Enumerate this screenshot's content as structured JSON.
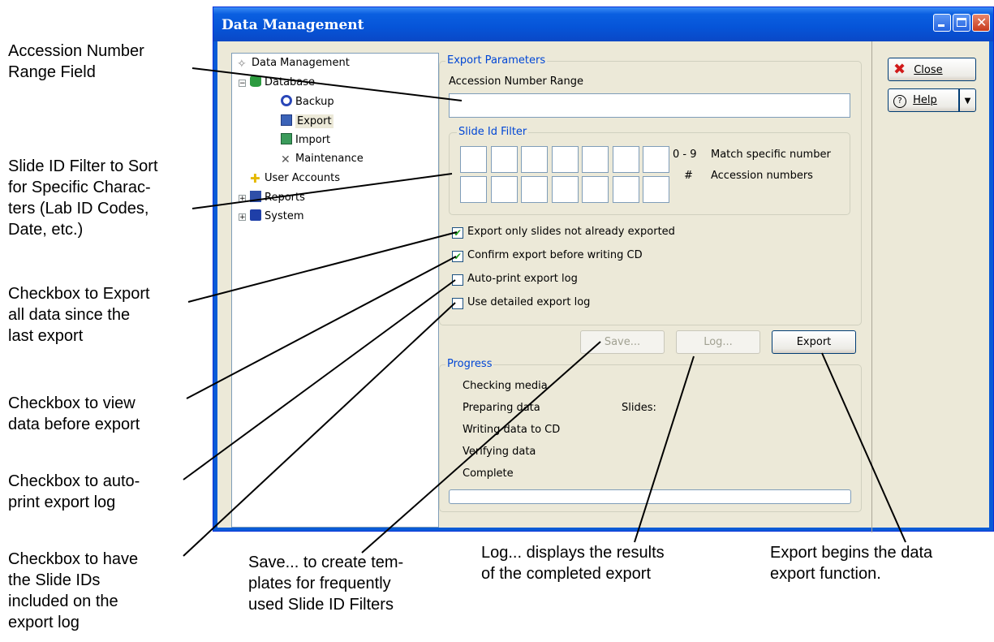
{
  "window": {
    "title": "Data Management"
  },
  "tree": {
    "items": [
      {
        "label": "Data Management",
        "icon": "data-management-icon"
      },
      {
        "label": "Database",
        "icon": "database-icon"
      },
      {
        "label": "Backup",
        "icon": "backup-icon"
      },
      {
        "label": "Export",
        "icon": "export-icon"
      },
      {
        "label": "Import",
        "icon": "import-icon"
      },
      {
        "label": "Maintenance",
        "icon": "maintenance-icon"
      },
      {
        "label": "User Accounts",
        "icon": "user-accounts-icon"
      },
      {
        "label": "Reports",
        "icon": "reports-icon"
      },
      {
        "label": "System",
        "icon": "system-icon"
      }
    ]
  },
  "export_params": {
    "group_label": "Export Parameters",
    "accession_label": "Accession Number Range",
    "accession_value": "",
    "slide_filter": {
      "group_label": "Slide Id Filter",
      "legend_1_key": "0 - 9",
      "legend_1_text": "Match specific number",
      "legend_2_key": "#",
      "legend_2_text": "Accession numbers"
    },
    "checkboxes": [
      {
        "label": "Export only slides not already exported",
        "checked": true
      },
      {
        "label": "Confirm export before writing CD",
        "checked": true
      },
      {
        "label": "Auto-print export log",
        "checked": false
      },
      {
        "label": "Use detailed export log",
        "checked": false
      }
    ]
  },
  "buttons": {
    "save": "Save...",
    "log": "Log...",
    "export": "Export",
    "close": "Close",
    "help": "Help"
  },
  "progress": {
    "group_label": "Progress",
    "steps": [
      "Checking media",
      "Preparing data",
      "Writing data to CD",
      "Verifying data",
      "Complete"
    ],
    "slides_label": "Slides:",
    "value": 0
  },
  "annotations": {
    "accession": "Accession Number\nRange Field",
    "slide_filter": "Slide ID Filter to Sort\nfor Specific Charac-\nters (Lab ID Codes,\nDate, etc.)",
    "export_since": "Checkbox to Export\nall data since the\nlast export",
    "view_before": "Checkbox to view\ndata before export",
    "auto_print": "Checkbox to auto-\nprint export log",
    "slide_ids": "Checkbox to have\nthe Slide IDs\nincluded on the\nexport log",
    "save": "Save... to create tem-\nplates for frequently\nused Slide ID Filters",
    "log": "Log... displays the results\nof the completed export",
    "export": "Export begins the data\nexport function."
  },
  "colors": {
    "titlebar": "#0a5fe0",
    "group_label": "#0046d5",
    "check_mark": "#21a121",
    "close_x": "#d11a1a"
  }
}
